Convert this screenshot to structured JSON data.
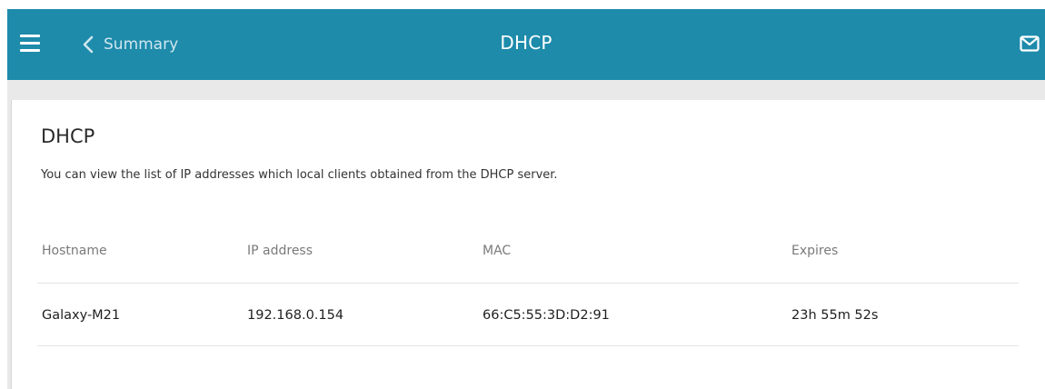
{
  "header": {
    "back_label": "Summary",
    "title": "DHCP",
    "menu_icon": "hamburger-icon",
    "back_icon": "chevron-left-icon",
    "mail_icon": "mail-icon",
    "bar_color": "#1e8bab"
  },
  "section": {
    "heading": "DHCP",
    "description": "You can view the list of IP addresses which local clients obtained from the DHCP server."
  },
  "table": {
    "columns": [
      "Hostname",
      "IP address",
      "MAC",
      "Expires"
    ],
    "rows": [
      [
        "Galaxy-M21",
        "192.168.0.154",
        "66:C5:55:3D:D2:91",
        "23h 55m 52s"
      ]
    ]
  }
}
